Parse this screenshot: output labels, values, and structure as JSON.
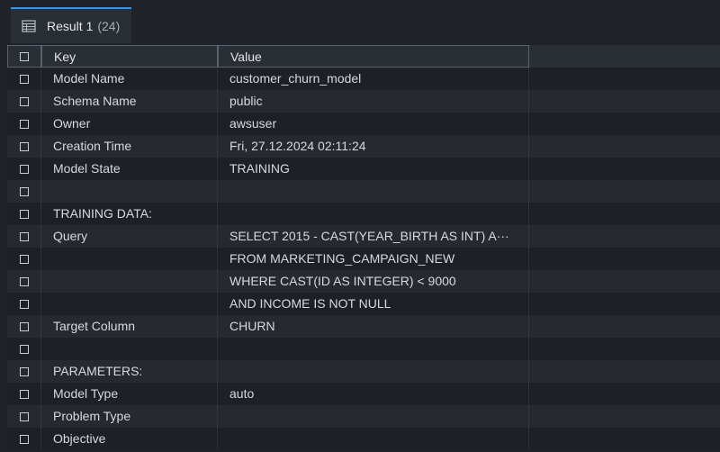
{
  "tab": {
    "title": "Result 1",
    "count": "(24)",
    "icon": "table-icon"
  },
  "columns": {
    "key": "Key",
    "value": "Value"
  },
  "rows": [
    {
      "key": "Model Name",
      "value": "customer_churn_model"
    },
    {
      "key": "Schema Name",
      "value": "public"
    },
    {
      "key": "Owner",
      "value": "awsuser"
    },
    {
      "key": "Creation Time",
      "value": "Fri, 27.12.2024 02:11:24"
    },
    {
      "key": "Model State",
      "value": "TRAINING"
    },
    {
      "key": "",
      "value": ""
    },
    {
      "key": "TRAINING DATA:",
      "value": ""
    },
    {
      "key": "Query",
      "value": "SELECT 2015 - CAST(YEAR_BIRTH AS INT) A···"
    },
    {
      "key": "",
      "value": "FROM MARKETING_CAMPAIGN_NEW"
    },
    {
      "key": "",
      "value": "WHERE CAST(ID AS INTEGER) < 9000"
    },
    {
      "key": "",
      "value": "AND INCOME IS NOT NULL"
    },
    {
      "key": "Target Column",
      "value": "CHURN"
    },
    {
      "key": "",
      "value": ""
    },
    {
      "key": "PARAMETERS:",
      "value": ""
    },
    {
      "key": "Model Type",
      "value": "auto"
    },
    {
      "key": "Problem Type",
      "value": ""
    },
    {
      "key": "Objective",
      "value": ""
    }
  ]
}
